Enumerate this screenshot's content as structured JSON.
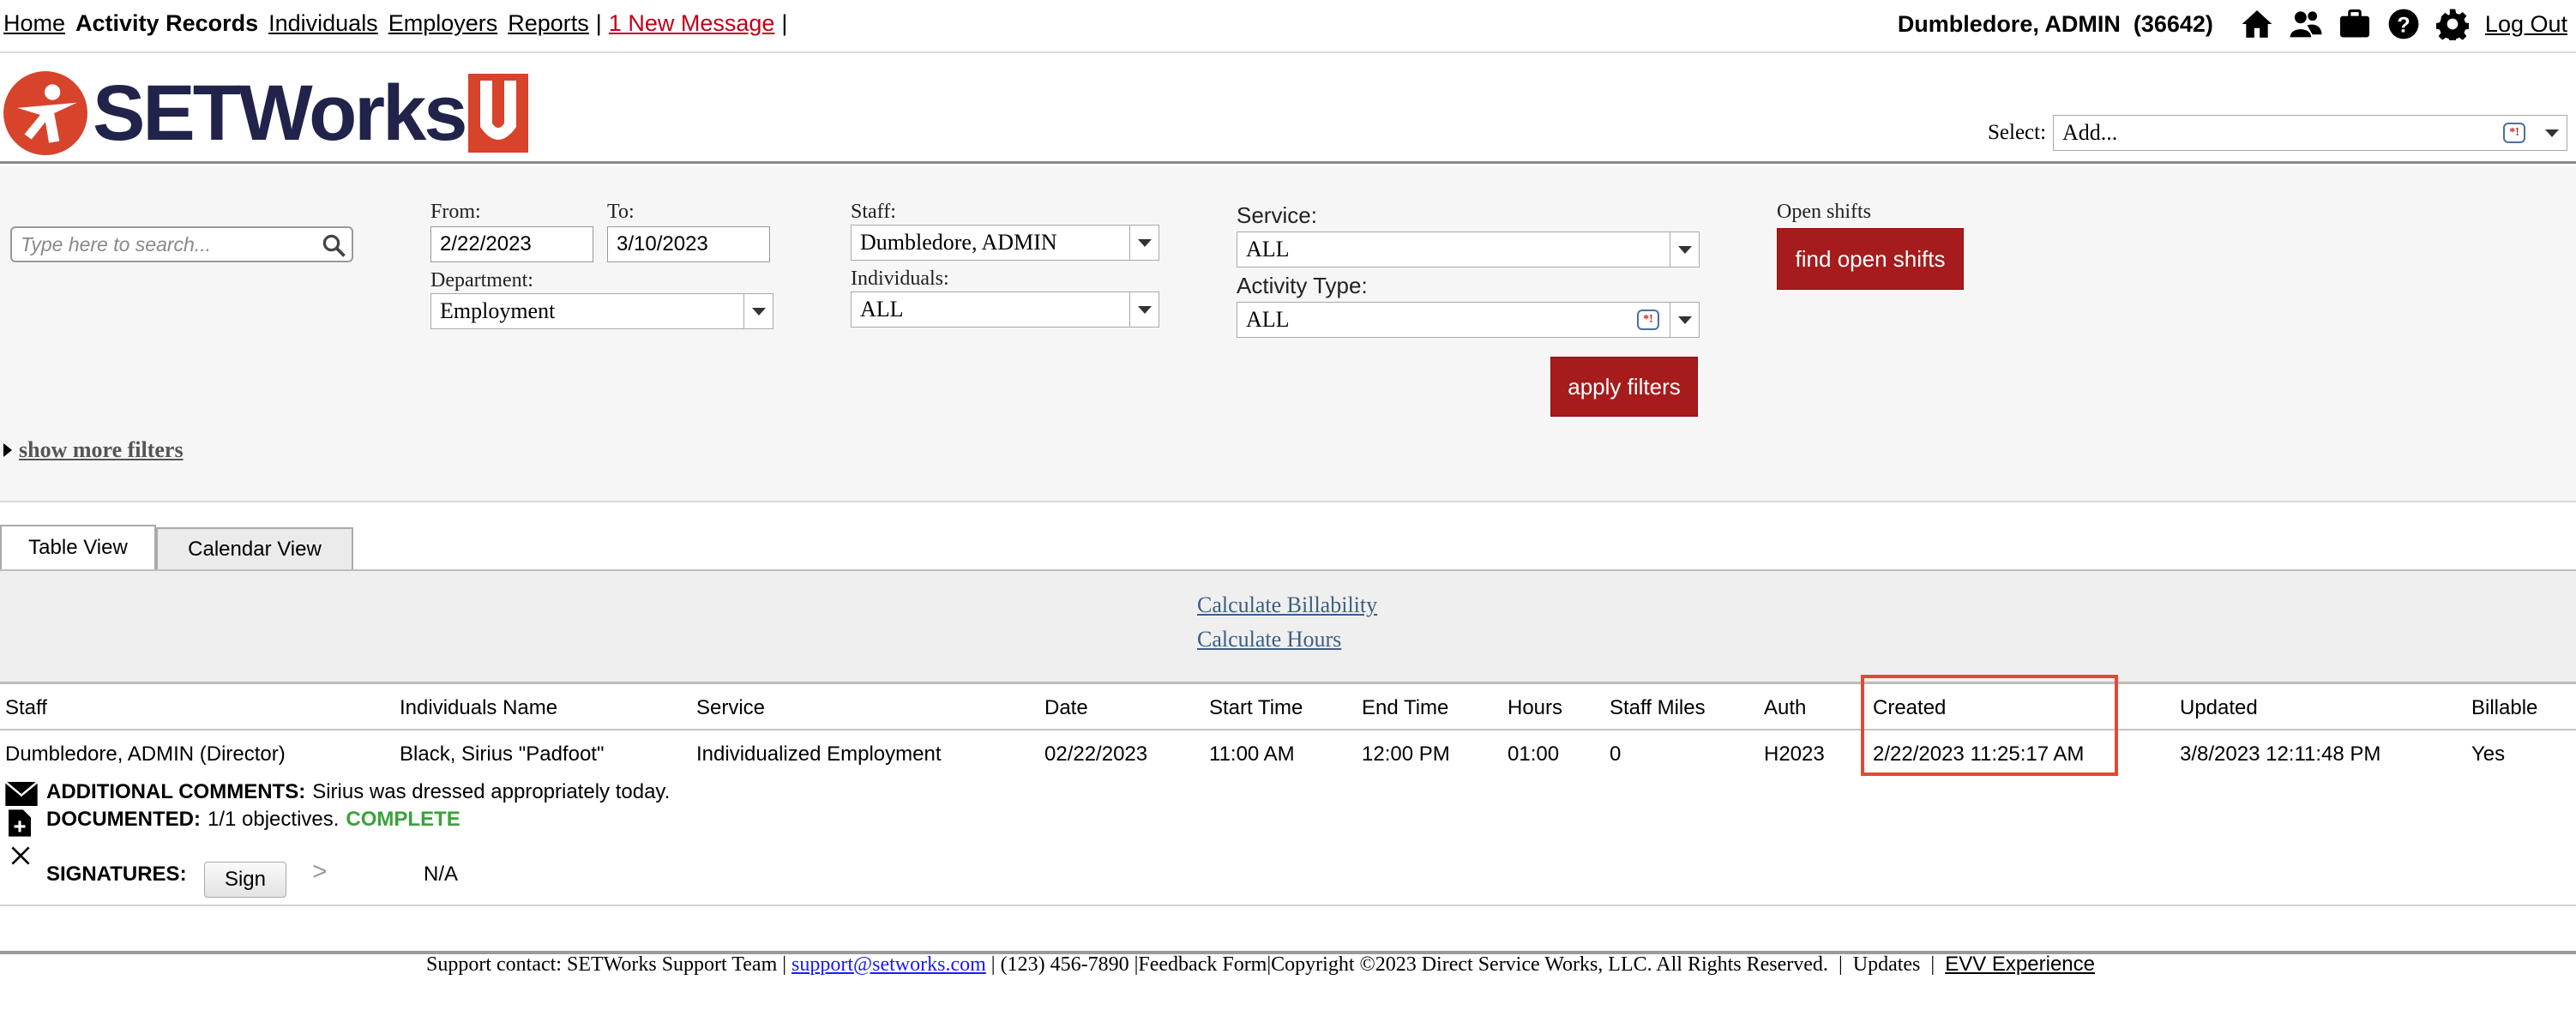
{
  "topnav": {
    "items": [
      {
        "label": "Home",
        "active": false
      },
      {
        "label": "Activity Records",
        "active": true
      },
      {
        "label": "Individuals",
        "active": false
      },
      {
        "label": "Employers",
        "active": false
      },
      {
        "label": "Reports",
        "active": false
      }
    ],
    "separator": "|",
    "message_link": "1 New Message",
    "user": "Dumbledore, ADMIN",
    "user_id": "(36642)",
    "logout": "Log Out",
    "icons": [
      "home-icon",
      "people-icon",
      "briefcase-icon",
      "help-icon",
      "gear-icon"
    ]
  },
  "header": {
    "logo_text": "SETWorks",
    "logo_u": "U",
    "select_label": "Select:",
    "select_value": "Add..."
  },
  "filters": {
    "search_placeholder": "Type here to search...",
    "from_label": "From:",
    "from_value": "2/22/2023",
    "to_label": "To:",
    "to_value": "3/10/2023",
    "department_label": "Department:",
    "department_value": "Employment",
    "staff_label": "Staff:",
    "staff_value": "Dumbledore, ADMIN",
    "individuals_label": "Individuals:",
    "individuals_value": "ALL",
    "service_label": "Service:",
    "service_value": "ALL",
    "activity_type_label": "Activity Type:",
    "activity_type_value": "ALL",
    "open_shifts_label": "Open shifts",
    "find_open_shifts": "find open shifts",
    "apply_filters": "apply filters",
    "show_more_filters": "show more filters"
  },
  "tabs": [
    {
      "label": "Table View",
      "active": true
    },
    {
      "label": "Calendar View",
      "active": false
    }
  ],
  "calc_links": {
    "billability": "Calculate Billability",
    "hours": "Calculate Hours"
  },
  "table": {
    "headers": [
      "Staff",
      "Individuals Name",
      "Service",
      "Date",
      "Start Time",
      "End Time",
      "Hours",
      "Staff Miles",
      "Auth",
      "Created",
      "Updated",
      "Billable"
    ],
    "rows": [
      [
        "Dumbledore, ADMIN (Director)",
        "Black, Sirius \"Padfoot\"",
        "Individualized Employment",
        "02/22/2023",
        "11:00 AM",
        "12:00 PM",
        "01:00",
        "0",
        "H2023",
        "2/22/2023 11:25:17 AM",
        "3/8/2023 12:11:48 PM",
        "Yes"
      ]
    ],
    "details": {
      "comments_label": "ADDITIONAL COMMENTS:",
      "comments_value": "Sirius was dressed appropriately today.",
      "documented_label": "DOCUMENTED:",
      "documented_value": "1/1 objectives.",
      "documented_status": "COMPLETE",
      "signatures_label": "SIGNATURES:",
      "sign_button": "Sign",
      "sign_arrow": ">",
      "signature_value": "N/A"
    }
  },
  "footer": {
    "support_text": "Support contact: SETWorks Support Team |",
    "support_email": "support@setworks.com",
    "rest_text": "| (123) 456-7890 |Feedback Form|Copyright ©2023 Direct Service Works, LLC. All Rights Reserved.",
    "sep1": "|",
    "updates": "Updates",
    "sep2": "|",
    "evv": "EVV Experience"
  }
}
